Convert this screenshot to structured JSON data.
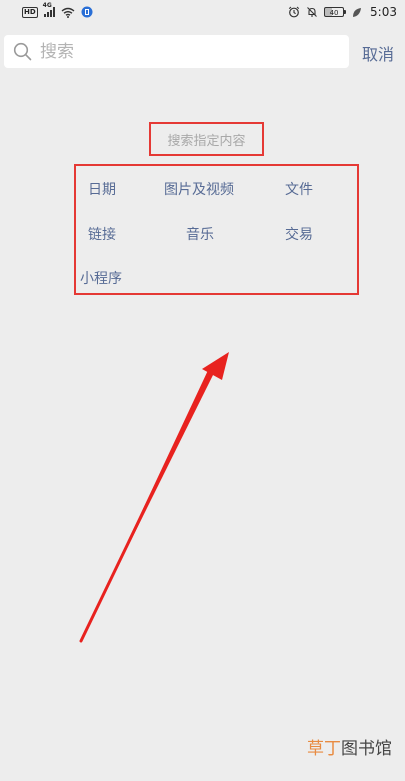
{
  "status_bar": {
    "left_badge": "HD",
    "signal_label": "4G",
    "battery_level": "40",
    "time": "5:03",
    "icons": [
      "hd-icon",
      "signal-icon",
      "wifi-icon",
      "vpn-icon",
      "alarm-icon",
      "mute-icon",
      "battery-icon",
      "leaf-icon"
    ]
  },
  "search": {
    "placeholder": "搜索",
    "value": "",
    "cancel_label": "取消",
    "icon": "search-icon"
  },
  "hint": {
    "text": "搜索指定内容"
  },
  "categories": [
    {
      "label": "日期"
    },
    {
      "label": "图片及视频"
    },
    {
      "label": "文件"
    },
    {
      "label": "链接"
    },
    {
      "label": "音乐"
    },
    {
      "label": "交易"
    },
    {
      "label": "小程序"
    }
  ],
  "colors": {
    "background": "#ededed",
    "link": "#576b95",
    "annotation_red": "#e53935",
    "hint_gray": "#a8a8a8"
  },
  "watermark": {
    "part1": "草丁",
    "part2": "图书馆"
  }
}
